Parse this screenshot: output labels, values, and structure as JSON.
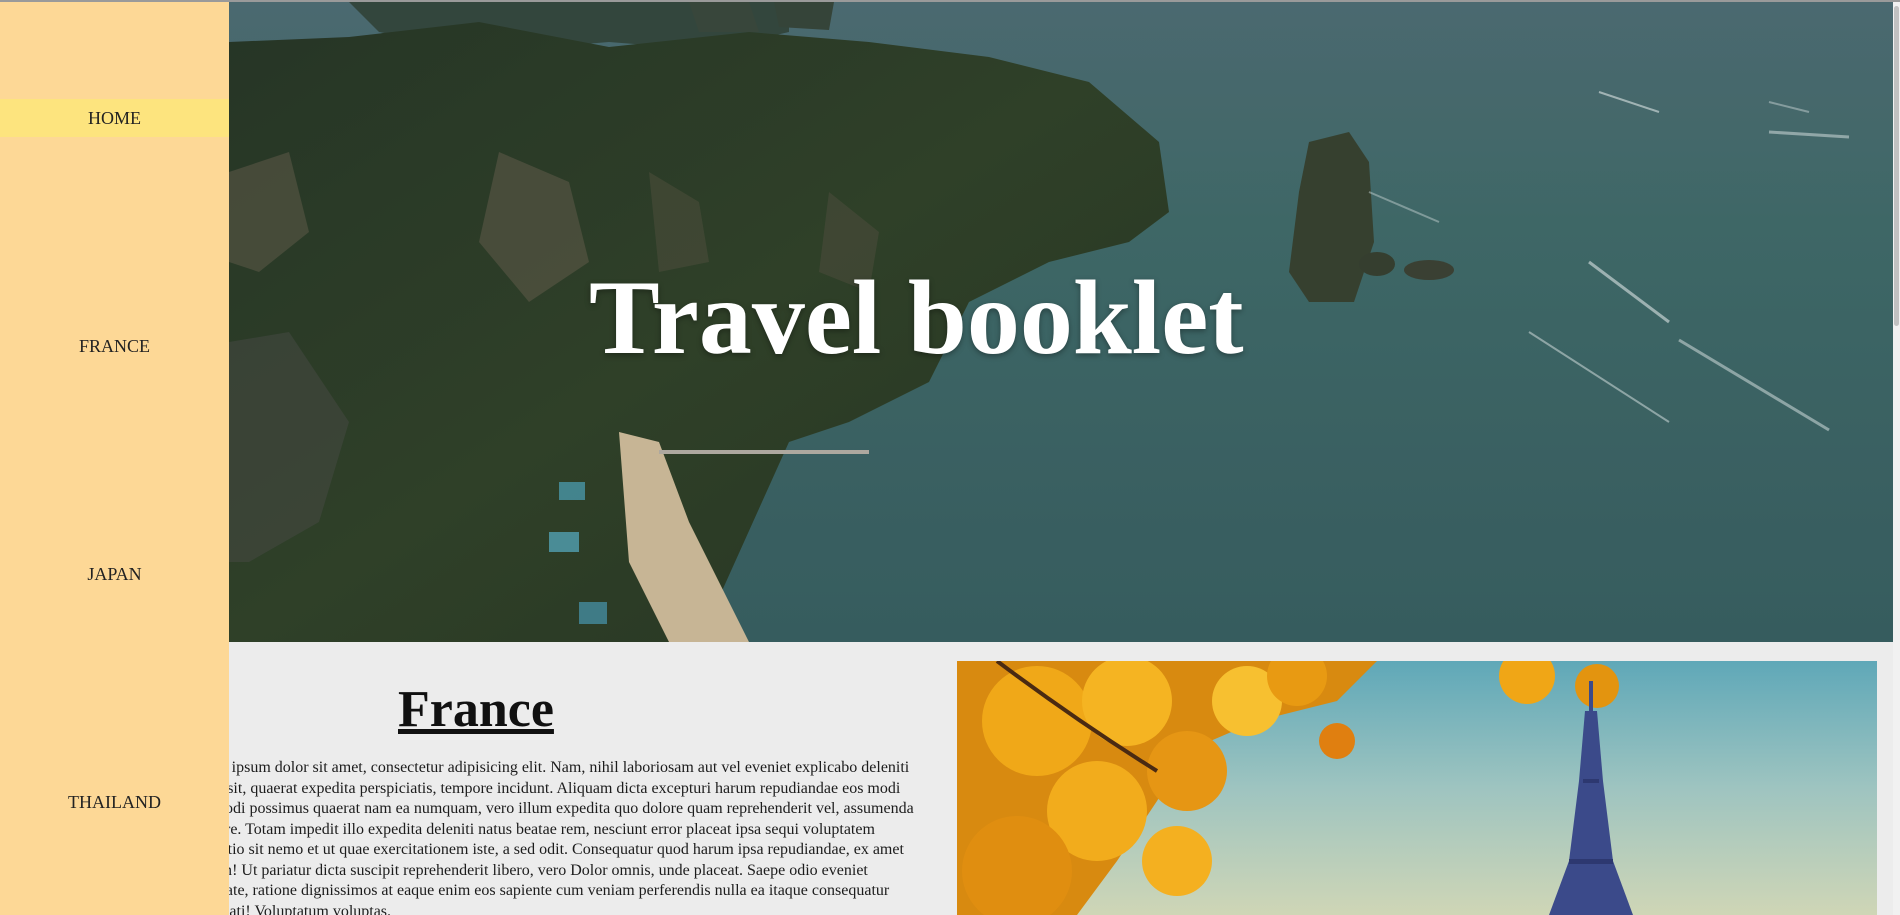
{
  "nav": {
    "items": [
      {
        "label": "HOME",
        "active": true
      },
      {
        "label": "FRANCE",
        "active": false
      },
      {
        "label": "JAPAN",
        "active": false
      },
      {
        "label": "THAILAND",
        "active": false
      }
    ]
  },
  "hero": {
    "title": "Travel booklet"
  },
  "france": {
    "title": "France",
    "text": "Lorem ipsum dolor sit amet, consectetur adipisicing elit. Nam, nihil laboriosam aut vel eveniet explicabo deleniti neque sit, quaerat expedita perspiciatis, tempore incidunt. Aliquam dicta excepturi harum repudiandae eos modi commodi possimus quaerat nam ea numquam, vero illum expedita quo dolore quam reprehenderit vel, assumenda tempore. Totam impedit illo expedita deleniti natus beatae rem, nesciunt error placeat ipsa sequi voluptatem distinctio sit nemo et ut quae exercitationem iste, a sed odit. Consequatur quod harum ipsa repudiandae, ex amet veniam! Ut pariatur dicta suscipit reprehenderit libero, vero Dolor omnis, unde placeat. Saepe odio eveniet voluptate, ratione dignissimos at eaque enim eos sapiente cum veniam perferendis nulla ea itaque consequatur obcaecati! Voluptatum voluptas."
  },
  "colors": {
    "sidebar": "#fdd896",
    "nav_active": "#fde47e",
    "page_bg": "#ececec"
  }
}
